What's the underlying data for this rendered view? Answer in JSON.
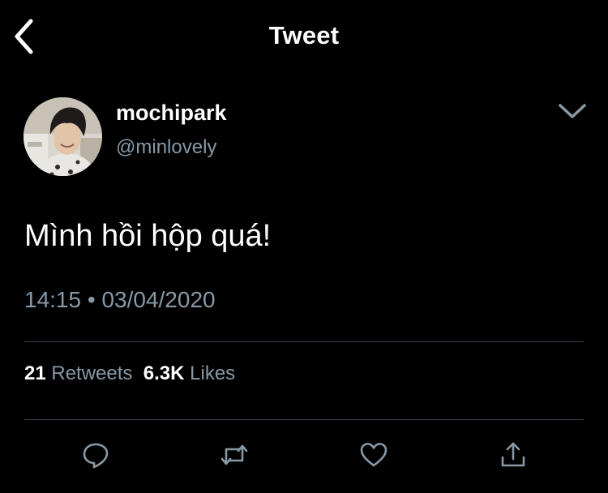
{
  "header": {
    "back_icon": "back-arrow-icon",
    "title": "Tweet"
  },
  "author": {
    "display_name": "mochipark",
    "handle": "@minlovely",
    "menu_icon": "chevron-down-icon"
  },
  "tweet": {
    "text": "Mình hồi hộp quá!",
    "time": "14:15",
    "separator": "•",
    "date": "03/04/2020"
  },
  "stats": {
    "retweets_count": "21",
    "retweets_label": "Retweets",
    "likes_count": "6.3K",
    "likes_label": "Likes"
  },
  "actions": [
    {
      "icon": "reply-icon"
    },
    {
      "icon": "retweet-icon"
    },
    {
      "icon": "like-heart-icon"
    },
    {
      "icon": "share-icon"
    }
  ],
  "colors": {
    "background": "#000000",
    "text": "#ffffff",
    "secondary_text": "#8899a6",
    "divider": "#38444d"
  }
}
